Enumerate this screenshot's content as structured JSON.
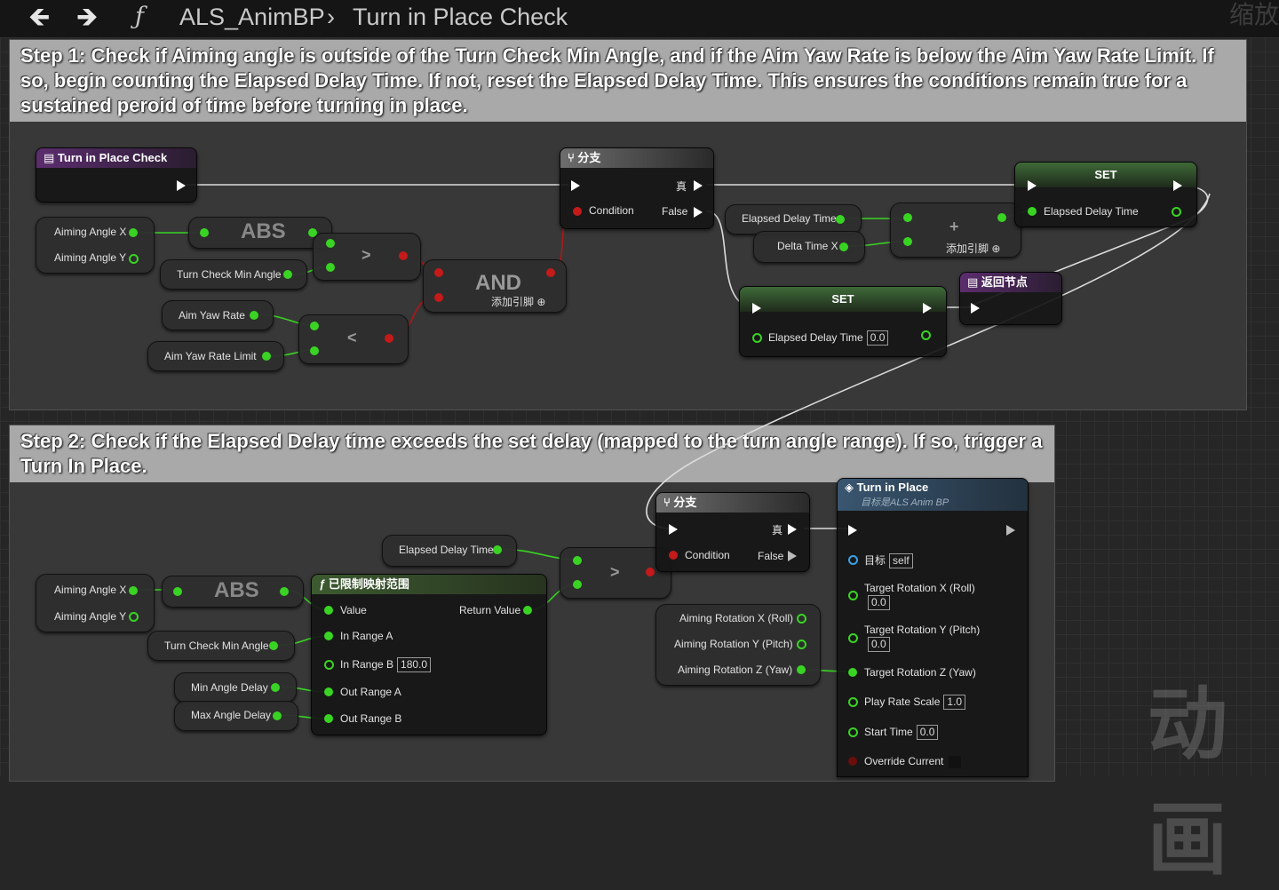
{
  "toolbar": {
    "back_icon": "arrow-left",
    "forward_icon": "arrow-right",
    "function_glyph": "ƒ",
    "asset": "ALS_AnimBP",
    "separator": "›",
    "graph": "Turn in Place Check",
    "zoom": "缩放"
  },
  "comments": {
    "step1": "Step 1: Check if Aiming angle is outside of the Turn Check Min Angle, and if the Aim Yaw Rate is below the Aim Yaw Rate Limit. If so, begin counting the Elapsed Delay Time. If not, reset the Elapsed Delay Time. This ensures the conditions remain true for a sustained peroid of time before turning in place.",
    "step2": "Step 2: Check if the Elapsed Delay time exceeds the set delay (mapped to the turn angle range). If so, trigger a Turn In Place."
  },
  "nodes": {
    "entry": "Turn in Place Check",
    "break1": {
      "x": "Aiming Angle X",
      "y": "Aiming Angle Y"
    },
    "abs": "ABS",
    "turn_check_min_angle": "Turn Check Min Angle",
    "gt": ">",
    "lt": "<",
    "aim_yaw_rate": "Aim Yaw Rate",
    "aim_yaw_rate_limit": "Aim Yaw Rate Limit",
    "and": "AND",
    "add_pin": "添加引脚",
    "branch": {
      "title": "分支",
      "condition": "Condition",
      "true": "真",
      "false": "False"
    },
    "elapsed_delay_time": "Elapsed Delay Time",
    "delta_time_x": "Delta Time X",
    "plus": "+",
    "set": "SET",
    "set_pin": "Elapsed Delay Time",
    "set_value": "0.0",
    "return": "返回节点",
    "map_range": {
      "title": "已限制映射范围",
      "value": "Value",
      "return_value": "Return Value",
      "in_a": "In Range A",
      "in_b": "In Range B",
      "in_b_val": "180.0",
      "out_a": "Out Range A",
      "out_b": "Out Range B"
    },
    "min_angle_delay": "Min Angle Delay",
    "max_angle_delay": "Max Angle Delay",
    "rot": {
      "x": "Aiming Rotation X (Roll)",
      "y": "Aiming Rotation Y (Pitch)",
      "z": "Aiming Rotation Z (Yaw)"
    },
    "tip": {
      "title": "Turn in Place",
      "subtitle": "目标是ALS Anim BP",
      "target": "目标",
      "target_val": "self",
      "rx": "Target Rotation X (Roll)",
      "rx_val": "0.0",
      "ry": "Target Rotation Y (Pitch)",
      "ry_val": "0.0",
      "rz": "Target Rotation Z (Yaw)",
      "rate": "Play Rate Scale",
      "rate_val": "1.0",
      "start": "Start Time",
      "start_val": "0.0",
      "override": "Override Current"
    }
  },
  "watermark": "动画"
}
